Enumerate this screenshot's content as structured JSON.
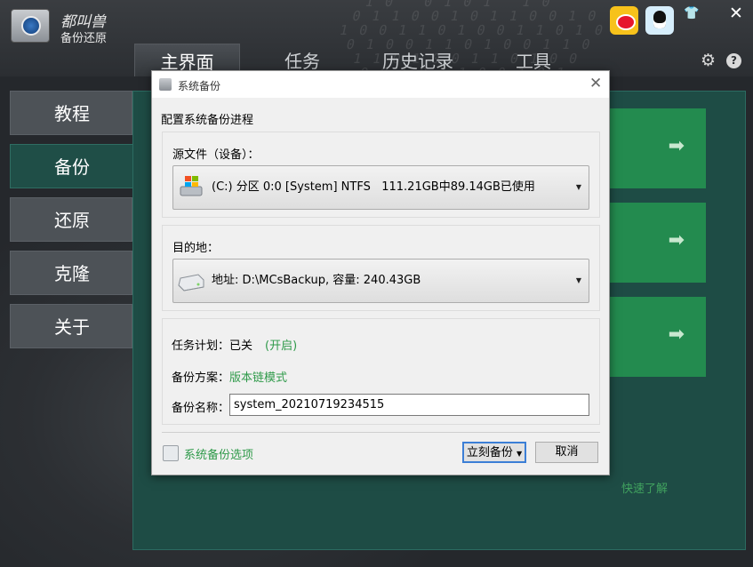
{
  "app": {
    "brand_title": "都叫兽",
    "brand_subtitle": "备份还原"
  },
  "tabs": [
    {
      "label": "主界面",
      "active": true
    },
    {
      "label": "任务",
      "active": false
    },
    {
      "label": "历史记录",
      "active": false
    },
    {
      "label": "工具",
      "active": false
    }
  ],
  "sidebar": {
    "items": [
      {
        "label": "教程",
        "active": false
      },
      {
        "label": "备份",
        "active": true
      },
      {
        "label": "还原",
        "active": false
      },
      {
        "label": "克隆",
        "active": false
      },
      {
        "label": "关于",
        "active": false
      }
    ]
  },
  "main": {
    "quick_link": "快速了解",
    "card_arrow": "➡"
  },
  "icons": {
    "gear": "⚙",
    "help": "?",
    "close": "✕",
    "tshirt": "👕"
  },
  "dialog": {
    "title": "系统备份",
    "close": "✕",
    "heading": "配置系统备份进程",
    "source_label": "源文件（设备）：",
    "source_value": "(C:) 分区 0:0 [System] NTFS   111.21GB中89.14GB已使用",
    "dest_label": "目的地：",
    "dest_value": "地址: D:\\MCsBackup, 容量: 240.43GB",
    "schedule_label": "任务计划：已关",
    "schedule_link": "(开启)",
    "scheme_label": "备份方案：",
    "scheme_value": "版本链模式",
    "name_label": "备份名称：",
    "name_value": "system_20210719234515",
    "options_link": "系统备份选项",
    "backup_button": "立刻备份",
    "cancel_button": "取消"
  },
  "colors": {
    "accent_green": "#238b4f",
    "panel_green": "#1e4c45",
    "link_green": "#2f9a4a"
  }
}
